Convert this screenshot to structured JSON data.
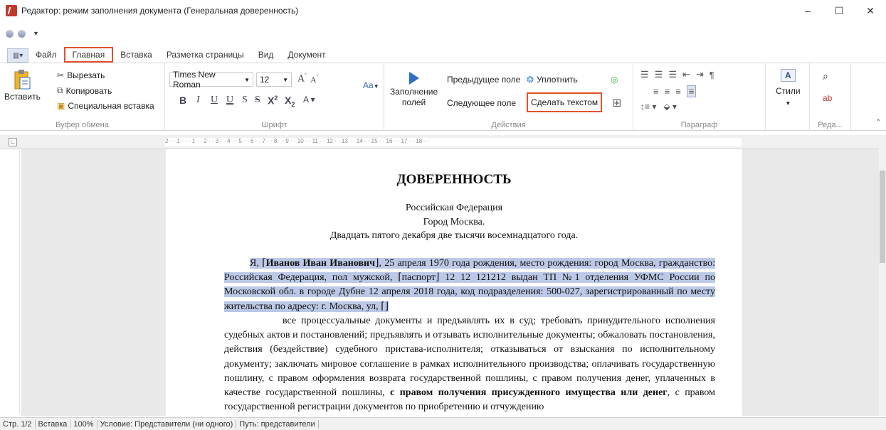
{
  "window": {
    "title": "Редактор: режим заполнения документа (Генеральная доверенность)",
    "controls": [
      "–",
      "☐",
      "✕"
    ]
  },
  "tabs": [
    "Файл",
    "Главная",
    "Вставка",
    "Разметка страницы",
    "Вид",
    "Документ"
  ],
  "active_tab": "Главная",
  "ribbon": {
    "clipboard": {
      "paste": "Вставить",
      "cut": "Вырезать",
      "copy": "Копировать",
      "paste_special": "Специальная вставка",
      "label": "Буфер обмена"
    },
    "font": {
      "family": "Times New Roman",
      "size": "12",
      "grow": "A",
      "shrink": "A",
      "change_case": "Aa",
      "label": "Шрифт"
    },
    "actions": {
      "fill_fields_line1": "Заполнение",
      "fill_fields_line2": "полей",
      "prev_field": "Предыдущее поле",
      "next_field": "Следующее поле",
      "compact": "Уплотнить",
      "make_text": "Сделать текстом",
      "label": "Действия"
    },
    "paragraph": {
      "label": "Параграф"
    },
    "styles": {
      "label": "Стили"
    },
    "editing": {
      "label": "Реда..."
    }
  },
  "ruler": {
    "scale": "2 · · 1 · · · 1 · · 2 · · 3 · · 4 · · 5 · · 6 · · 7 · · 8 · · 9 · · 10 · · 11 · · 12 · · 13 · · 14 · · 15 · · 16 · · 17 · · 18 · ·"
  },
  "document": {
    "title": "ДОВЕРЕННОСТЬ",
    "line1": "Российская Федерация",
    "line2": "Город Москва.",
    "line3": "Двадцать пятого декабря две тысячи восемнадцатого года.",
    "p1_start": "Я, ⌈",
    "p1_name": "Иванов Иван Иванович",
    "p1_rest": "⌋, 25 апреля 1970 года рождения, место рождения: город Москва, гражданство: Российская Федерация, пол мужской, ⌈паспорт⌋ 12 12 121212 выдан ТП №1 отделения УФМС России по Московской обл. в городе Дубне 12 апреля 2018 года, код подразделения: 500-027, зарегистрированный по месту жительства по адресу: г. Москва, ул, ⌈⌋",
    "p2_text": "все процессуальные документы и предъявлять их в суд; требовать принудительного исполнения судебных актов и постановлений; предъявлять и отзывать исполнительные документы; обжаловать постановления, действия (бездействие) судебного пристава-исполнителя; отказываться от взыскания по исполнительному документу; заключать мировое соглашение в рамках исполнительного производства; оплачивать государственную пошлину, с правом оформления возврата государственной пошлины, с правом получения денег, уплаченных в качестве государственной пошлины, ",
    "p2_bold": "с правом получения присужденного имущества или денег",
    "p2_tail": ", с правом государственной регистрации документов по приобретению и отчуждению"
  },
  "status": {
    "page": "Стр. 1/2",
    "mode": "Вставка",
    "zoom": "100%",
    "condition": "Условие: Представители (ни одного)",
    "path": "Путь: представители"
  }
}
